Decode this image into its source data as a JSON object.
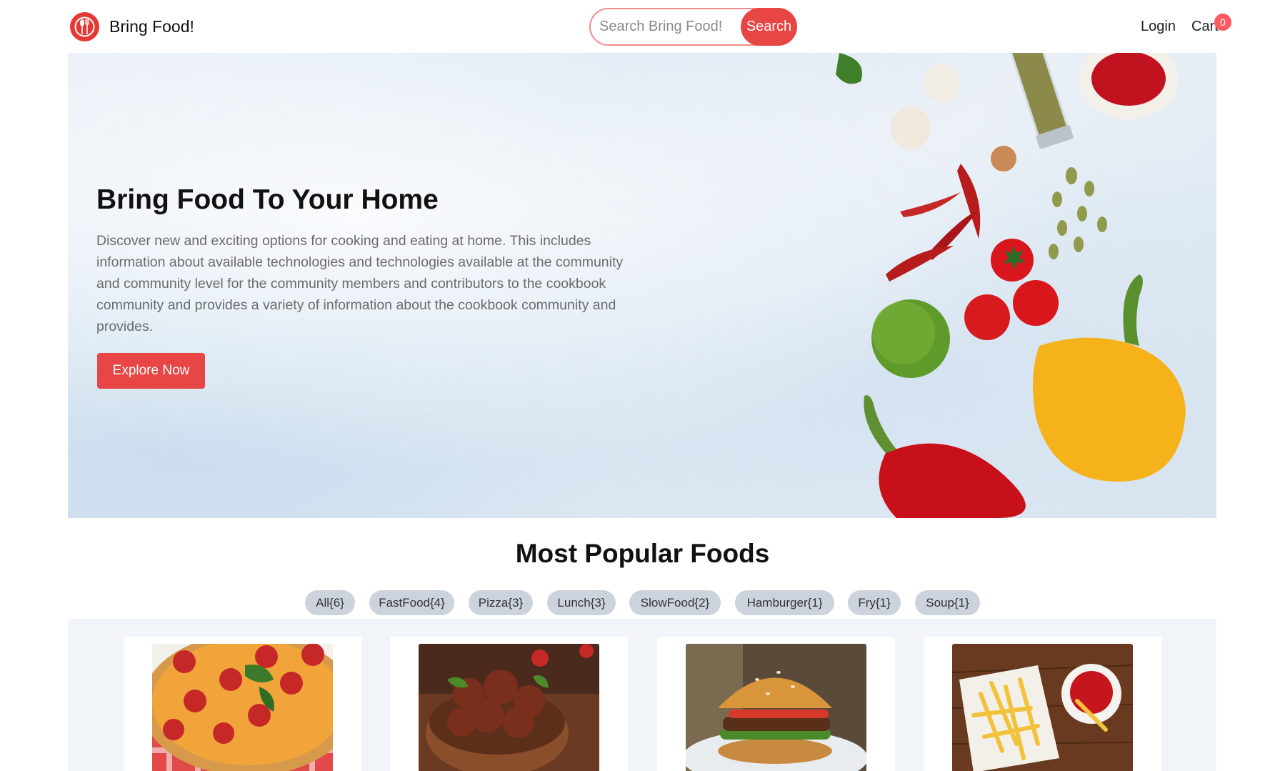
{
  "brand": {
    "name": "Bring Food!",
    "logo_icon": "fork-spoon-icon",
    "accent": "#e84545"
  },
  "search": {
    "placeholder": "Search Bring Food!",
    "button_label": "Search"
  },
  "nav": {
    "login_label": "Login",
    "cart_label": "Cart",
    "cart_count": "0"
  },
  "hero": {
    "title": "Bring Food To Your Home",
    "description": "Discover new and exciting options for cooking and eating at home. This includes information about available technologies and technologies available at the community and community level for the community members and contributors to the cookbook community and provides a variety of information about the cookbook community and provides.",
    "cta_label": "Explore Now"
  },
  "popular": {
    "title": "Most Popular Foods",
    "filters": [
      {
        "label": "All{6}"
      },
      {
        "label": "FastFood{4}"
      },
      {
        "label": "Pizza{3}"
      },
      {
        "label": "Lunch{3}"
      },
      {
        "label": "SlowFood{2}"
      },
      {
        "label": "Hamburger{1}"
      },
      {
        "label": "Fry{1}"
      },
      {
        "label": "Soup{1}"
      }
    ],
    "products": [
      {
        "image_icon": "pizza-icon"
      },
      {
        "image_icon": "meatballs-icon"
      },
      {
        "image_icon": "burger-icon"
      },
      {
        "image_icon": "fries-icon"
      }
    ]
  }
}
